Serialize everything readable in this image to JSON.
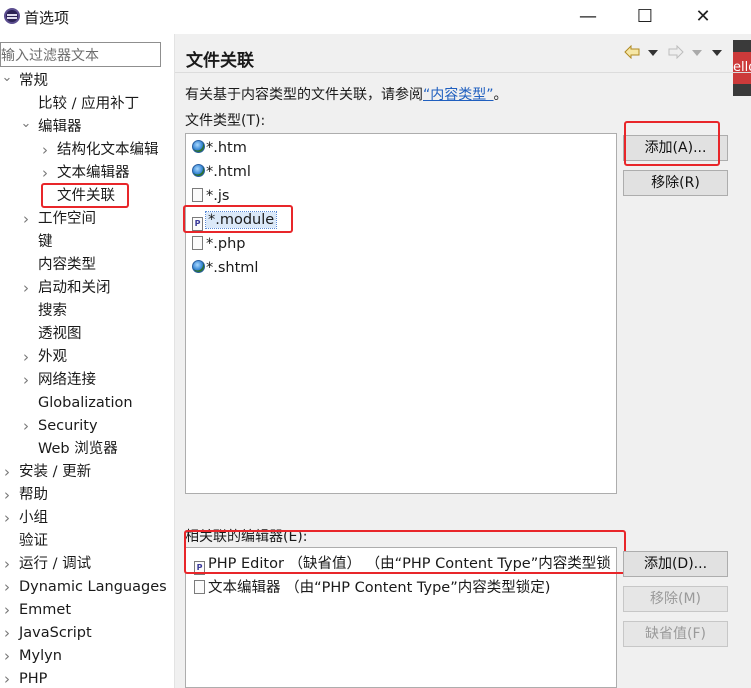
{
  "window": {
    "title": "首选项",
    "minimize": "—",
    "maximize": "☐",
    "close": "✕"
  },
  "filter": {
    "placeholder": "输入过滤器文本"
  },
  "tree": [
    {
      "label": "常规",
      "indent": 0,
      "toggle": "open"
    },
    {
      "label": "比较 / 应用补丁",
      "indent": 1,
      "toggle": "none"
    },
    {
      "label": "编辑器",
      "indent": 1,
      "toggle": "open"
    },
    {
      "label": "结构化文本编辑",
      "indent": 2,
      "toggle": "closed"
    },
    {
      "label": "文本编辑器",
      "indent": 2,
      "toggle": "closed"
    },
    {
      "label": "文件关联",
      "indent": 2,
      "toggle": "none",
      "selected": true
    },
    {
      "label": "工作空间",
      "indent": 1,
      "toggle": "closed"
    },
    {
      "label": "键",
      "indent": 1,
      "toggle": "none"
    },
    {
      "label": "内容类型",
      "indent": 1,
      "toggle": "none"
    },
    {
      "label": "启动和关闭",
      "indent": 1,
      "toggle": "closed"
    },
    {
      "label": "搜索",
      "indent": 1,
      "toggle": "none"
    },
    {
      "label": "透视图",
      "indent": 1,
      "toggle": "none"
    },
    {
      "label": "外观",
      "indent": 1,
      "toggle": "closed"
    },
    {
      "label": "网络连接",
      "indent": 1,
      "toggle": "closed"
    },
    {
      "label": "Globalization",
      "indent": 1,
      "toggle": "none"
    },
    {
      "label": "Security",
      "indent": 1,
      "toggle": "closed"
    },
    {
      "label": "Web 浏览器",
      "indent": 1,
      "toggle": "none"
    },
    {
      "label": "安装 / 更新",
      "indent": 0,
      "toggle": "closed"
    },
    {
      "label": "帮助",
      "indent": 0,
      "toggle": "closed"
    },
    {
      "label": "小组",
      "indent": 0,
      "toggle": "closed"
    },
    {
      "label": "验证",
      "indent": 0,
      "toggle": "none"
    },
    {
      "label": "运行 / 调试",
      "indent": 0,
      "toggle": "closed"
    },
    {
      "label": "Dynamic Languages",
      "indent": 0,
      "toggle": "closed"
    },
    {
      "label": "Emmet",
      "indent": 0,
      "toggle": "closed"
    },
    {
      "label": "JavaScript",
      "indent": 0,
      "toggle": "closed"
    },
    {
      "label": "Mylyn",
      "indent": 0,
      "toggle": "closed"
    },
    {
      "label": "PHP",
      "indent": 0,
      "toggle": "closed"
    }
  ],
  "page": {
    "title": "文件关联",
    "description_prefix": "有关基于内容类型的文件关联，请参阅",
    "description_link": "“内容类型”",
    "description_suffix": "。",
    "file_types_label": "文件类型(T):",
    "file_types": [
      {
        "name": "*.htm",
        "icon": "globe-icon"
      },
      {
        "name": "*.html",
        "icon": "globe-icon"
      },
      {
        "name": "*.js",
        "icon": "file-icon"
      },
      {
        "name": "*.module",
        "icon": "php-file-icon",
        "selected": true
      },
      {
        "name": "*.php",
        "icon": "file-icon"
      },
      {
        "name": "*.shtml",
        "icon": "globe-icon"
      }
    ],
    "add_button": "添加(A)...",
    "remove_button": "移除(R)",
    "editors_label": "相关联的编辑器(E):",
    "editors": [
      {
        "name": "PHP Editor （缺省值） （由“PHP Content Type”内容类型锁",
        "icon": "php-file-icon"
      },
      {
        "name": "文本编辑器 （由“PHP Content Type”内容类型锁定)",
        "icon": "text-file-icon"
      }
    ],
    "add_editor_button": "添加(D)...",
    "remove_editor_button": "移除(M)",
    "default_button": "缺省值(F)"
  },
  "side_strip_text": "ello",
  "colors": {
    "highlight": "#e8262a",
    "link": "#1f5fbf"
  }
}
